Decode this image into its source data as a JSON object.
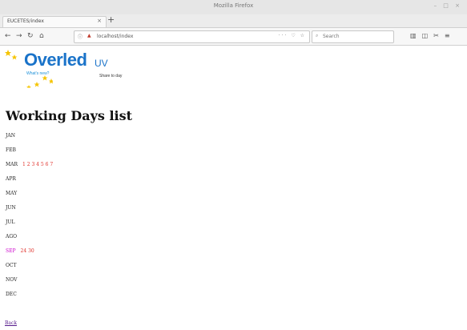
{
  "window": {
    "title": "Mozilla Firefox"
  },
  "tab": {
    "label": "EUCETES/index",
    "close": "×"
  },
  "newtab": "+",
  "nav": {
    "url": "localhost/index",
    "search_placeholder": "Search"
  },
  "logo": {
    "name": "Overled",
    "suffix": "UV",
    "tagline": "What's new?",
    "tagline2": "Share to day"
  },
  "page": {
    "heading": "Working Days list",
    "months": [
      {
        "name": "JAN",
        "days": ""
      },
      {
        "name": "FEB",
        "days": ""
      },
      {
        "name": "MAR",
        "days": "1 2 3 4 5 6 7"
      },
      {
        "name": "APR",
        "days": ""
      },
      {
        "name": "MAY",
        "days": ""
      },
      {
        "name": "JUN",
        "days": ""
      },
      {
        "name": "JUL",
        "days": ""
      },
      {
        "name": "AGO",
        "days": ""
      },
      {
        "name": "SEP",
        "days": "24 30"
      },
      {
        "name": "OCT",
        "days": ""
      },
      {
        "name": "NOV",
        "days": ""
      },
      {
        "name": "DEC",
        "days": ""
      }
    ],
    "back_label": "Back"
  },
  "colors": {
    "logo_blue": "#1a73c9",
    "day_red": "#e0302a",
    "highlight_magenta": "#cc00cc",
    "link_visited": "#551a8b"
  }
}
